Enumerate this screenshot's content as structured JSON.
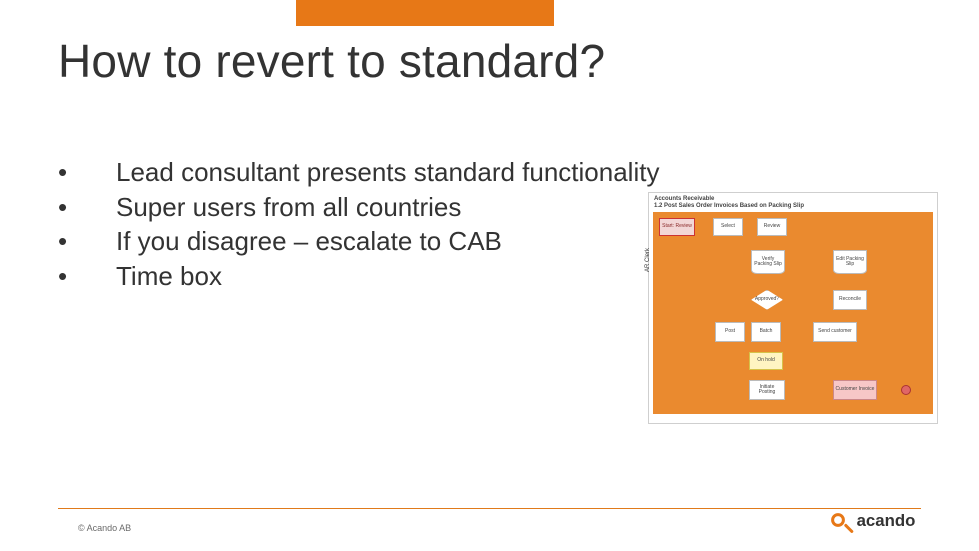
{
  "colors": {
    "accent": "#e77817",
    "rule": "#e07a1a",
    "diagram_bg": "#ea8a2f"
  },
  "title": "How to revert to standard?",
  "bullets": [
    "Lead consultant presents standard functionality",
    "Super users from all countries",
    "If you disagree – escalate to CAB",
    "Time box"
  ],
  "diagram": {
    "header_line1": "Accounts Receivable",
    "header_line2": "1.2 Post Sales Order Invoices Based on Packing Slip",
    "swimlane_label": "AR Clerk",
    "nodes": {
      "start": "Start: Review",
      "a1": "Select",
      "a2": "Review",
      "b1": "Verify Packing Slip",
      "b2": "Edit Packing Slip",
      "c_decision": "Approved?",
      "c_side": "Reconcile",
      "d1": "Post",
      "d2": "Batch",
      "d3": "Send customer",
      "e_warn": "On hold",
      "f1": "Initiate Posting",
      "g_pink": "Customer Invoice"
    }
  },
  "copyright": "© Acando AB",
  "logo_text": "acando"
}
